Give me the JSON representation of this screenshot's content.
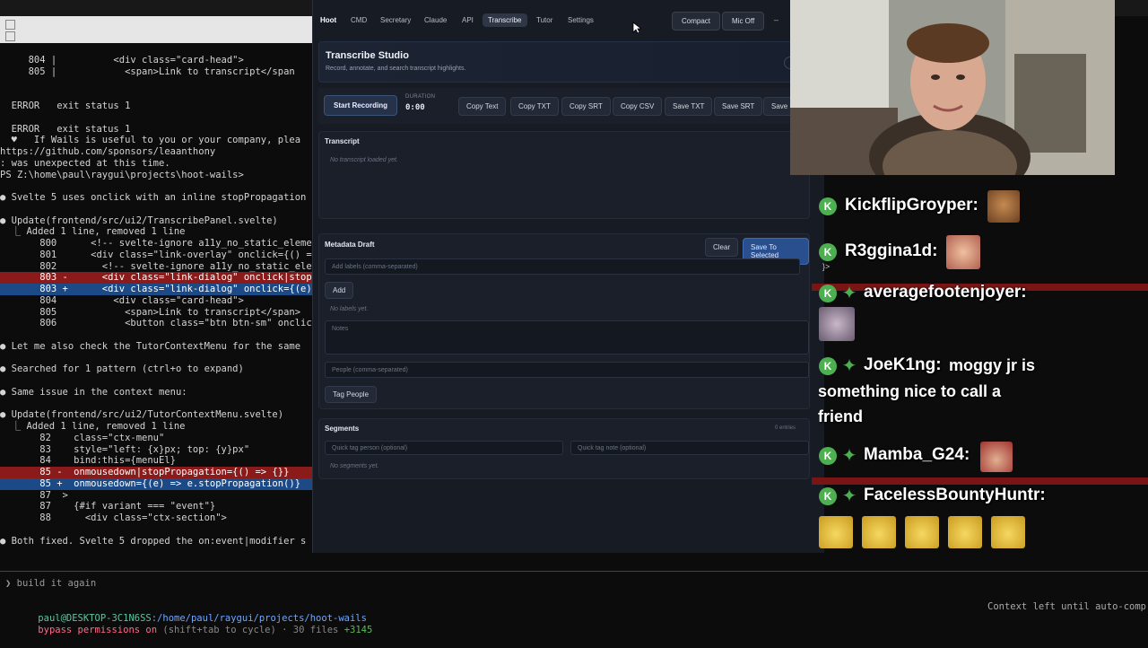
{
  "terminal": {
    "lines": [
      "     804 |          <div class=\"card-head\">",
      "     805 |            <span>Link to transcript</span",
      "",
      "",
      "  ERROR   exit status 1",
      "",
      "  ERROR   exit status 1",
      "  ♥   If Wails is useful to you or your company, plea",
      "https://github.com/sponsors/leaanthony",
      ": was unexpected at this time.",
      "PS Z:\\home\\paul\\raygui\\projects\\hoot-wails>",
      "",
      "● Svelte 5 uses onclick with an inline stopPropagation",
      "",
      "● Update(frontend/src/ui2/TranscribePanel.svelte)",
      "  ⎿ Added 1 line, removed 1 line",
      "       800      <!-- svelte-ignore a11y_no_static_eleme",
      "       801      <div class=\"link-overlay\" onclick={() =",
      "       802        <!-- svelte-ignore a11y_no_static_ele",
      "       803 -      <div class=\"link-dialog\" onclick|stop",
      "       803 +      <div class=\"link-dialog\" onclick={(e)",
      "       804          <div class=\"card-head\">",
      "       805            <span>Link to transcript</span>",
      "       806            <button class=\"btn btn-sm\" onclic",
      "",
      "● Let me also check the TutorContextMenu for the same",
      "",
      "● Searched for 1 pattern (ctrl+o to expand)",
      "",
      "● Same issue in the context menu:",
      "",
      "● Update(frontend/src/ui2/TutorContextMenu.svelte)",
      "  ⎿ Added 1 line, removed 1 line",
      "       82    class=\"ctx-menu\"",
      "       83    style=\"left: {x}px; top: {y}px\"",
      "       84    bind:this={menuEl}",
      "       85 -  onmousedown|stopPropagation={() => {}}",
      "       85 +  onmousedown={(e) => e.stopPropagation()}",
      "       87  >",
      "       87    {#if variant === \"event\"}",
      "       88      <div class=\"ctx-section\">",
      "",
      "● Both fixed. Svelte 5 dropped the on:event|modifier s"
    ],
    "prompt_input": "❯ build it again",
    "user_host": "paul@DESKTOP-3C1N6SS",
    "path": ":/home/paul/raygui/projects/hoot-wails",
    "bypass_text": "bypass permissions on",
    "bypass_hint": " (shift+tab to cycle) · 30 files ",
    "added_count": "+3145",
    "context_text": "Context left until auto-comp"
  },
  "app": {
    "brand": "Hoot",
    "tabs": [
      "CMD",
      "Secretary",
      "Claude",
      "API",
      "Transcribe",
      "Tutor",
      "Settings"
    ],
    "active_tab": "Transcribe",
    "compact_label": "Compact",
    "mic_label": "Mic Off",
    "minimize_label": "–",
    "studio_title": "Transcribe Studio",
    "studio_subtitle": "Record, annotate, and search transcript highlights.",
    "start_recording": "Start Recording",
    "duration_label": "DURATION",
    "duration_value": "0:00",
    "actions": [
      "Copy Text",
      "Copy TXT",
      "Copy SRT",
      "Copy CSV",
      "Save TXT",
      "Save SRT",
      "Save C"
    ],
    "transcript_title": "Transcript",
    "transcript_empty": "No transcript loaded yet.",
    "metadata_title": "Metadata Draft",
    "clear_label": "Clear",
    "save_selected_label": "Save To Selected",
    "labels_placeholder": "Add labels (comma-separated)",
    "add_label": "Add",
    "no_labels": "No labels yet.",
    "notes_placeholder": "Notes",
    "people_placeholder": "People (comma-separated)",
    "tag_people_label": "Tag People",
    "segments_title": "Segments",
    "segments_count": "0 entries",
    "quick_person_placeholder": "Quick tag person (optional)",
    "quick_note_placeholder": "Quick tag note (optional)",
    "no_segments": "No segments yet."
  },
  "chat": {
    "messages": [
      {
        "user": "KickflipGroyper:",
        "text": ""
      },
      {
        "user": "R3ggina1d:",
        "text": ""
      },
      {
        "user": "averagefootenjoyer:",
        "text": ""
      },
      {
        "user": "JoeK1ng:",
        "text": "moggy jr is",
        "text2": "something nice to call a",
        "text3": "friend"
      },
      {
        "user": "Mamba_G24:",
        "text": ""
      },
      {
        "user": "FacelessBountyHuntr:",
        "text": ""
      }
    ],
    "badge_letter": "K",
    "diamond": "✦",
    "fragment": "}>"
  },
  "colors": {
    "accent": "#2f6fd6",
    "chat_badge": "#4caf50",
    "red_band": "#7a1515"
  }
}
